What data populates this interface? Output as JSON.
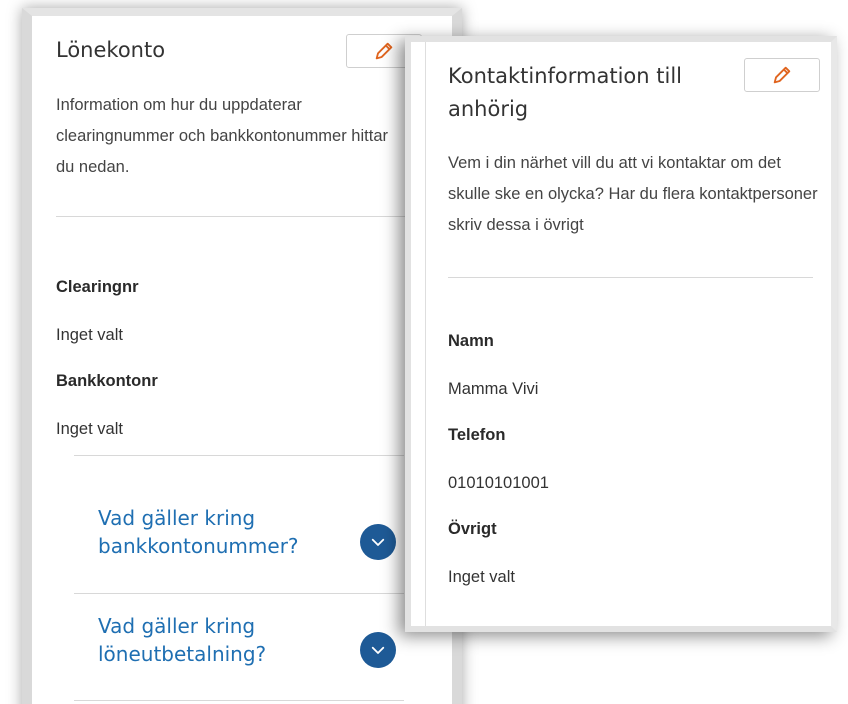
{
  "left_card": {
    "title": "Lönekonto",
    "edit_icon": "pencil-icon",
    "description": "Information om hur du uppdaterar clearingnummer och bankkontonummer hittar du nedan.",
    "fields": [
      {
        "label": "Clearingnr",
        "value": "Inget valt"
      },
      {
        "label": "Bankkontonr",
        "value": "Inget valt"
      }
    ],
    "faq": [
      {
        "question": "Vad gäller kring bankkontonummer?",
        "icon": "chevron-down-icon"
      },
      {
        "question": "Vad gäller kring löneutbetalning?",
        "icon": "chevron-down-icon"
      }
    ]
  },
  "right_card": {
    "title": "Kontaktinformation till anhörig",
    "edit_icon": "pencil-icon",
    "description": "Vem i din närhet vill du att vi kontaktar om det skulle ske en olycka? Har du flera kontaktpersoner skriv dessa i övrigt",
    "fields": [
      {
        "label": "Namn",
        "value": "Mamma Vivi"
      },
      {
        "label": "Telefon",
        "value": "01010101001"
      },
      {
        "label": "Övrigt",
        "value": "Inget valt"
      }
    ]
  },
  "colors": {
    "accent_blue": "#1f6fb2",
    "chevron_bg": "#1e5a96",
    "pencil": "#e0641e"
  }
}
